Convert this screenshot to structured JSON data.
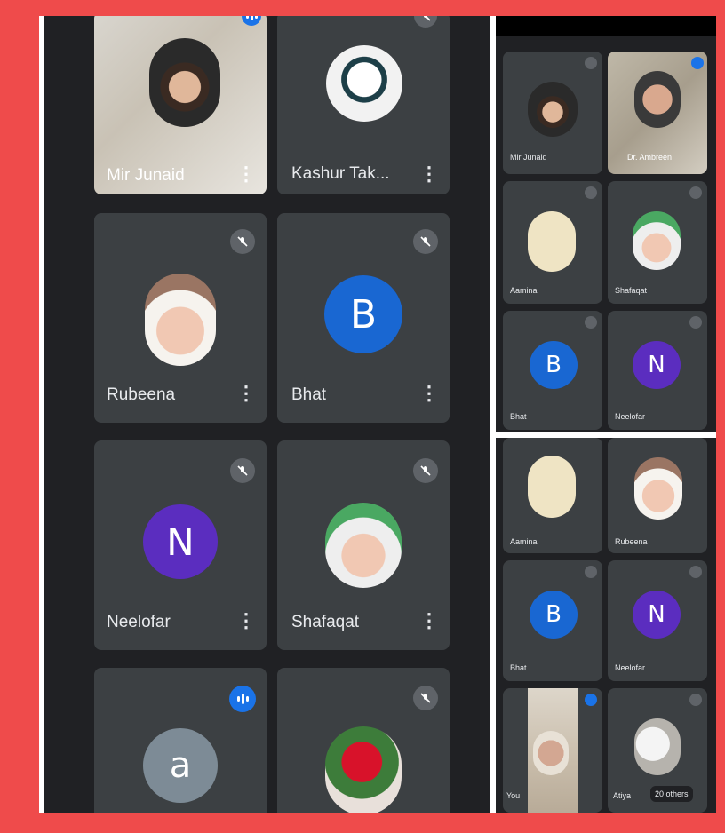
{
  "main_grid": {
    "tiles": [
      {
        "name": "Mir Junaid"
      },
      {
        "name": "Kashur Tak..."
      },
      {
        "name": "Rubeena"
      },
      {
        "name": "Bhat",
        "initial": "B"
      },
      {
        "name": "Neelofar",
        "initial": "N"
      },
      {
        "name": "Shafaqat"
      },
      {
        "initial": "a"
      },
      {}
    ]
  },
  "side_top": {
    "tiles": [
      {
        "name": "Mir Junaid"
      },
      {
        "name": "Dr. Ambreen"
      },
      {
        "name": "Aamina"
      },
      {
        "name": "Shafaqat"
      },
      {
        "name": "Bhat",
        "initial": "B"
      },
      {
        "name": "Neelofar",
        "initial": "N"
      }
    ]
  },
  "side_bottom": {
    "tiles": [
      {
        "name": "Aamina"
      },
      {
        "name": "Rubeena"
      },
      {
        "name": "Bhat",
        "initial": "B"
      },
      {
        "name": "Neelofar",
        "initial": "N"
      },
      {
        "name": "You"
      },
      {
        "name": "Atiya"
      }
    ],
    "others_label": "20 others"
  },
  "menu_icon": "⋮",
  "colors": {
    "page_background": "#ef4b4b",
    "meet_background": "#202124",
    "tile_background": "#3c4043",
    "speaking_blue": "#1a73e8",
    "avatar_blue": "#1967d2",
    "avatar_purple": "#5b2dbf",
    "avatar_grey": "#7d8b96"
  },
  "icons": [
    "mic-off-icon",
    "speaking-indicator-icon",
    "more-options-icon"
  ]
}
